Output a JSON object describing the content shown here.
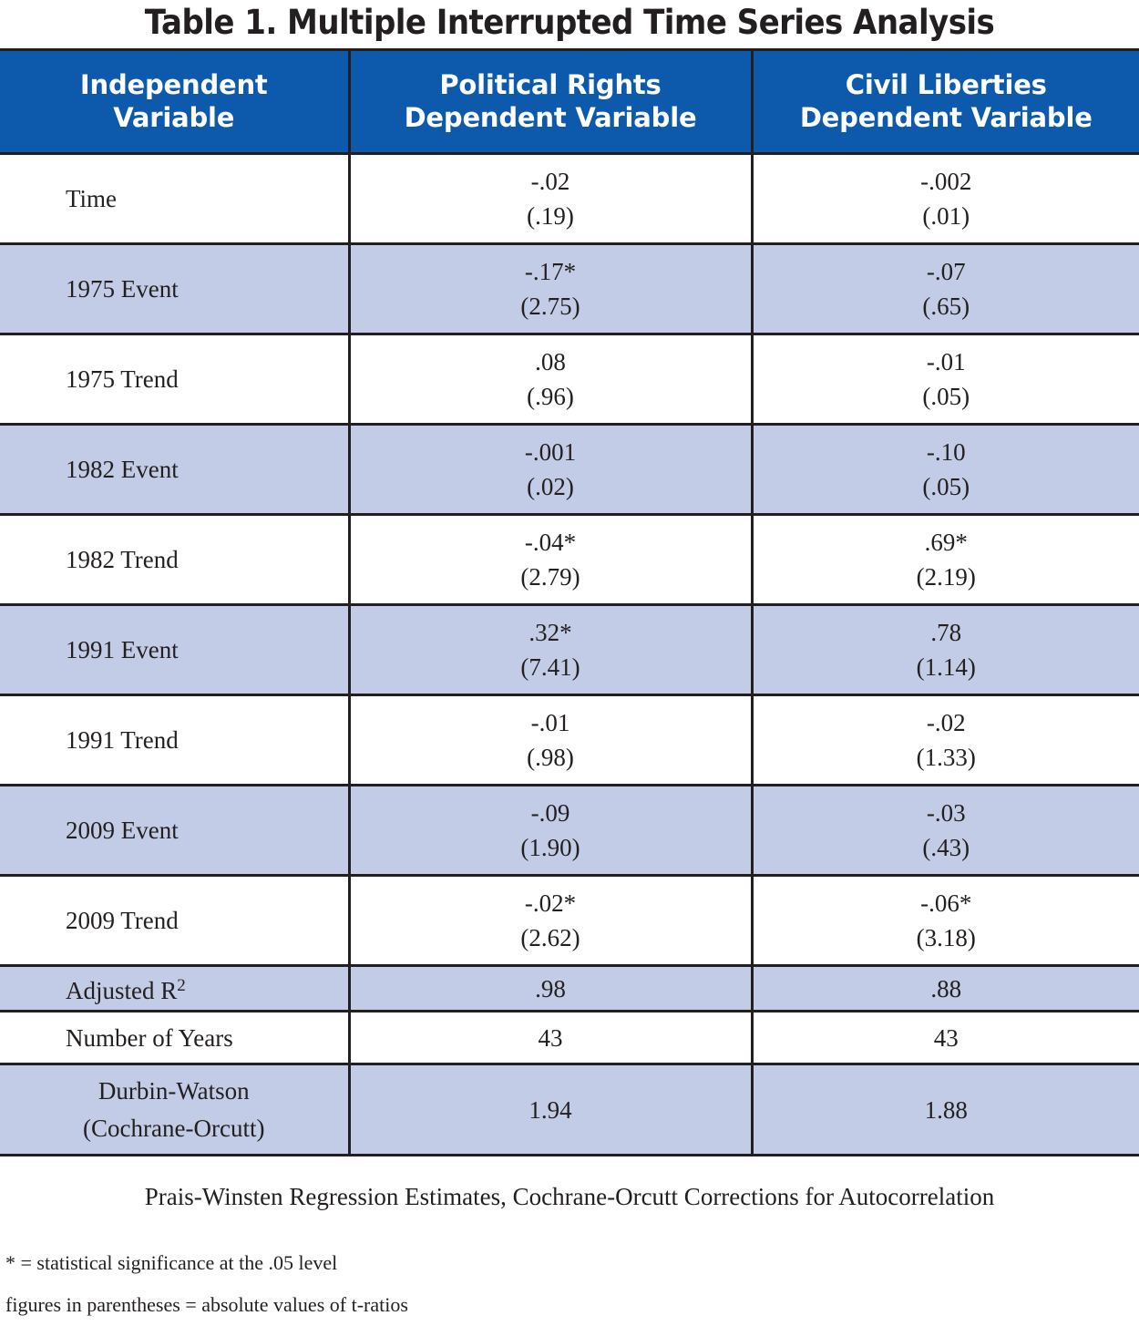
{
  "title": "Table 1. Multiple Interrupted Time Series Analysis",
  "columns": [
    "Independent\nVariable",
    "Political Rights\nDependent Variable",
    "Civil Liberties\nDependent Variable"
  ],
  "header": {
    "col1_line1": "Independent",
    "col1_line2": "Variable",
    "col2_line1": "Political Rights",
    "col2_line2": "Dependent Variable",
    "col3_line1": "Civil Liberties",
    "col3_line2": "Dependent Variable"
  },
  "colors": {
    "header_blue": "#0d5aac",
    "row_shade": "#c3cce6",
    "row_plain": "#ffffff",
    "border": "#231f20",
    "text": "#231f20",
    "header_text": "#ffffff"
  },
  "rows": [
    {
      "label": "Time",
      "pr_coef": "-.02",
      "pr_t": "(.19)",
      "cl_coef": "-.002",
      "cl_t": "(.01)"
    },
    {
      "label": "1975 Event",
      "pr_coef": "-.17*",
      "pr_t": "(2.75)",
      "cl_coef": "-.07",
      "cl_t": "(.65)"
    },
    {
      "label": "1975 Trend",
      "pr_coef": ".08",
      "pr_t": "(.96)",
      "cl_coef": "-.01",
      "cl_t": "(.05)"
    },
    {
      "label": "1982 Event",
      "pr_coef": "-.001",
      "pr_t": "(.02)",
      "cl_coef": "-.10",
      "cl_t": "(.05)"
    },
    {
      "label": "1982 Trend",
      "pr_coef": "-.04*",
      "pr_t": "(2.79)",
      "cl_coef": ".69*",
      "cl_t": "(2.19)"
    },
    {
      "label": "1991 Event",
      "pr_coef": ".32*",
      "pr_t": "(7.41)",
      "cl_coef": ".78",
      "cl_t": "(1.14)"
    },
    {
      "label": "1991 Trend",
      "pr_coef": "-.01",
      "pr_t": "(.98)",
      "cl_coef": "-.02",
      "cl_t": "(1.33)"
    },
    {
      "label": "2009 Event",
      "pr_coef": "-.09",
      "pr_t": "(1.90)",
      "cl_coef": "-.03",
      "cl_t": "(.43)"
    },
    {
      "label": "2009 Trend",
      "pr_coef": "-.02*",
      "pr_t": "(2.62)",
      "cl_coef": "-.06*",
      "cl_t": "(3.18)"
    }
  ],
  "summary": {
    "adjusted_r2_label_base": "Adjusted R",
    "adjusted_r2_label_sup": "2",
    "adjusted_r2_pr": ".98",
    "adjusted_r2_cl": ".88",
    "years_label": "Number of Years",
    "years_pr": "43",
    "years_cl": "43",
    "dw_label_line1": "Durbin-Watson",
    "dw_label_line2": "(Cochrane-Orcutt)",
    "dw_pr": "1.94",
    "dw_cl": "1.88"
  },
  "notes": {
    "method": "Prais-Winsten Regression Estimates, Cochrane-Orcutt Corrections for Autocorrelation",
    "significance": "* = statistical significance at the .05 level",
    "parentheses": "figures in parentheses = absolute values of t-ratios"
  },
  "chart_data": {
    "type": "table",
    "title": "Table 1. Multiple Interrupted Time Series Analysis",
    "columns": [
      "Independent Variable",
      "Political Rights Dependent Variable",
      "Civil Liberties Dependent Variable"
    ],
    "rows": [
      [
        "Time",
        "-.02 (.19)",
        "-.002 (.01)"
      ],
      [
        "1975 Event",
        "-.17* (2.75)",
        "-.07 (.65)"
      ],
      [
        "1975 Trend",
        ".08 (.96)",
        "-.01 (.05)"
      ],
      [
        "1982 Event",
        "-.001 (.02)",
        "-.10 (.05)"
      ],
      [
        "1982 Trend",
        "-.04* (2.79)",
        ".69* (2.19)"
      ],
      [
        "1991 Event",
        ".32* (7.41)",
        ".78 (1.14)"
      ],
      [
        "1991 Trend",
        "-.01 (.98)",
        "-.02 (1.33)"
      ],
      [
        "2009 Event",
        "-.09 (1.90)",
        "-.03 (.43)"
      ],
      [
        "2009 Trend",
        "-.02* (2.62)",
        "-.06* (3.18)"
      ],
      [
        "Adjusted R2",
        ".98",
        ".88"
      ],
      [
        "Number of Years",
        "43",
        "43"
      ],
      [
        "Durbin-Watson (Cochrane-Orcutt)",
        "1.94",
        "1.88"
      ]
    ],
    "coefficients": {
      "political_rights": [
        -0.02,
        -0.17,
        0.08,
        -0.001,
        -0.04,
        0.32,
        -0.01,
        -0.09,
        -0.02
      ],
      "civil_liberties": [
        -0.002,
        -0.07,
        -0.01,
        -0.1,
        0.69,
        0.78,
        -0.02,
        -0.03,
        -0.06
      ]
    },
    "t_ratios": {
      "political_rights": [
        0.19,
        2.75,
        0.96,
        0.02,
        2.79,
        7.41,
        0.98,
        1.9,
        2.62
      ],
      "civil_liberties": [
        0.01,
        0.65,
        0.05,
        0.05,
        2.19,
        1.14,
        1.33,
        0.43,
        3.18
      ]
    },
    "significant_at_05": {
      "political_rights": [
        false,
        true,
        false,
        false,
        true,
        true,
        false,
        false,
        true
      ],
      "civil_liberties": [
        false,
        false,
        false,
        false,
        true,
        false,
        false,
        false,
        true
      ]
    },
    "fit_statistics": {
      "adjusted_r2": [
        0.98,
        0.88
      ],
      "n_years": [
        43,
        43
      ],
      "durbin_watson": [
        1.94,
        1.88
      ]
    },
    "notes": [
      "Prais-Winsten Regression Estimates, Cochrane-Orcutt Corrections for Autocorrelation",
      "* = statistical significance at the .05 level",
      "figures in parentheses = absolute values of t-ratios"
    ]
  }
}
